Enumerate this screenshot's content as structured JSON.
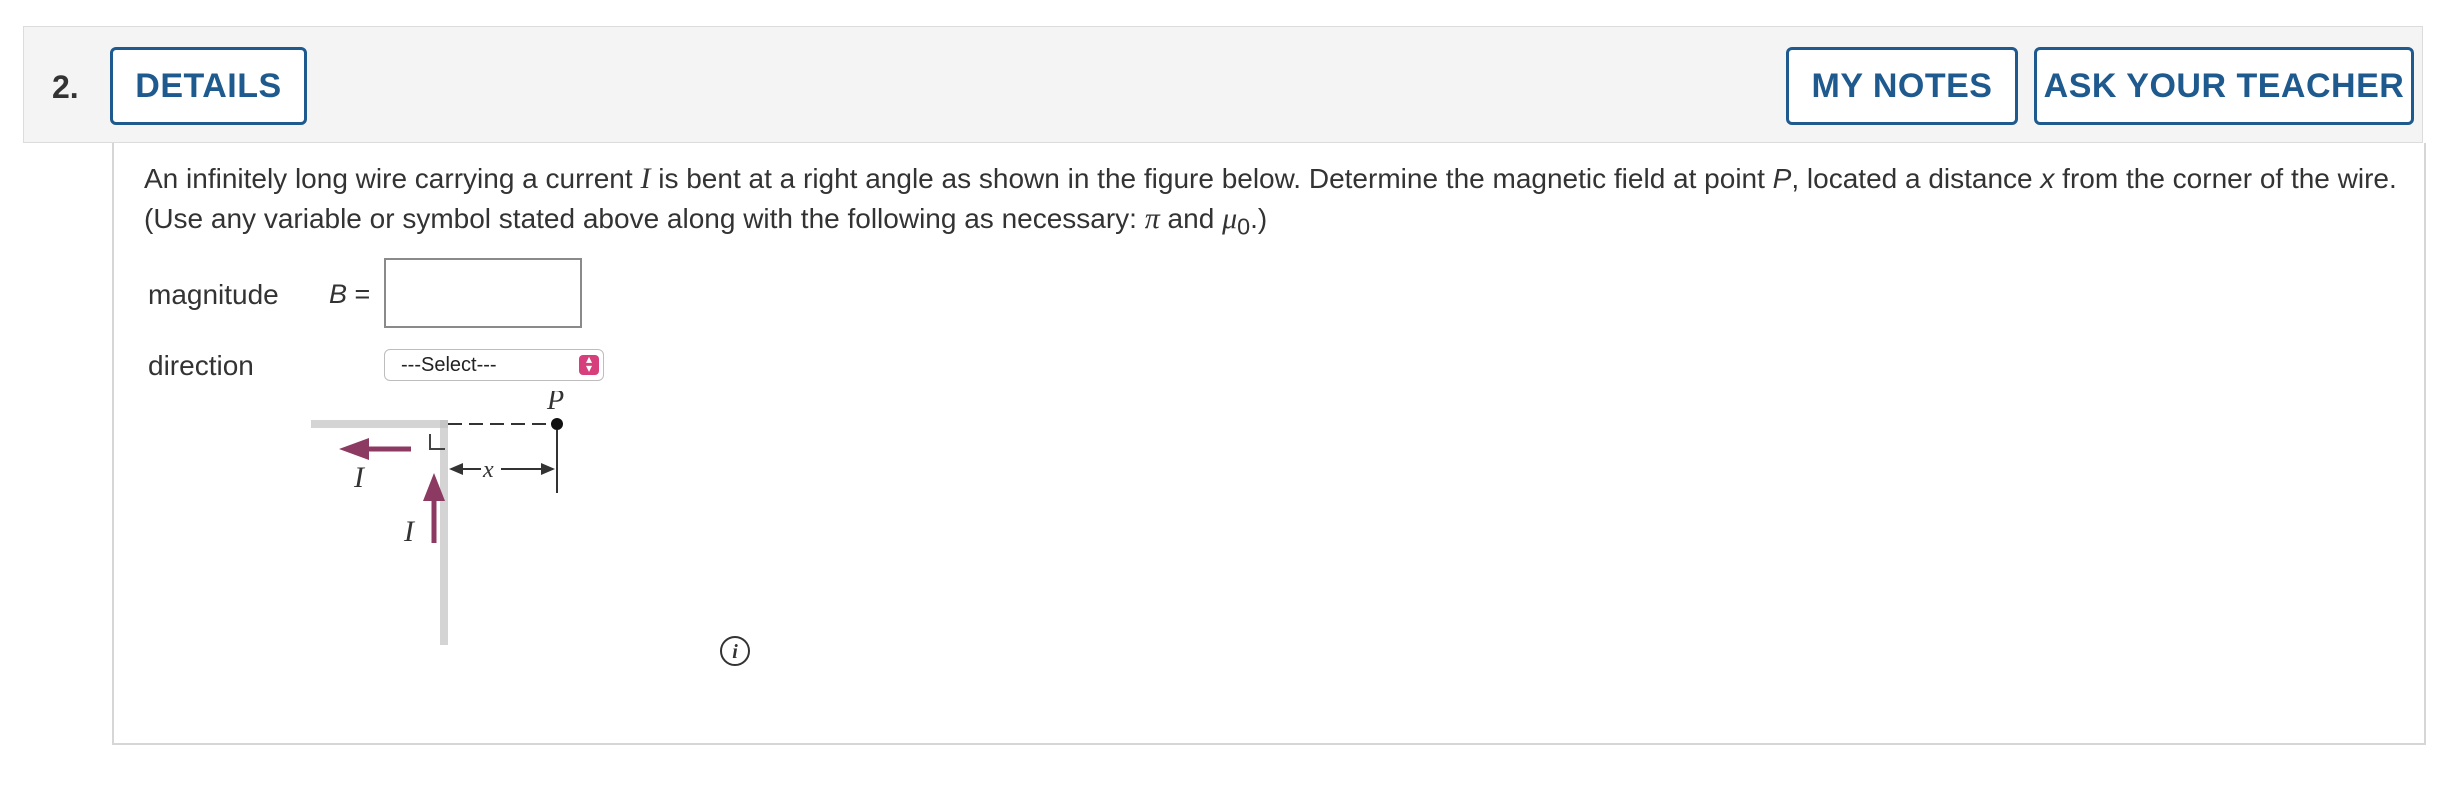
{
  "question": {
    "number": "2.",
    "buttons": {
      "details": "DETAILS",
      "my_notes": "MY NOTES",
      "ask_teacher": "ASK YOUR TEACHER"
    },
    "prompt": {
      "p1": "An infinitely long wire carrying a current ",
      "var_I": "I",
      "p2": " is bent at a right angle as shown in the figure below. Determine the magnetic field at point ",
      "var_P": "P",
      "p3": ", located a distance ",
      "var_x": "x",
      "p4": " from the corner of the wire. (Use any variable or symbol stated above along with the following as necessary: ",
      "pi": "π",
      "p5": " and ",
      "mu": "μ",
      "mu_sub": "0",
      "p6": ".)"
    },
    "magnitude": {
      "label": "magnitude",
      "symbol": "B",
      "equals": "=",
      "value": ""
    },
    "direction": {
      "label": "direction",
      "selected": "---Select---"
    },
    "figure": {
      "label_P": "P",
      "label_I_horizontal": "I",
      "label_I_vertical": "I",
      "label_x": "x",
      "wire_color": "#d4d4d4",
      "arrow_color": "#8c3a62"
    },
    "icons": {
      "info": "info-icon",
      "select_arrow": "chevron-up-down-icon"
    }
  }
}
